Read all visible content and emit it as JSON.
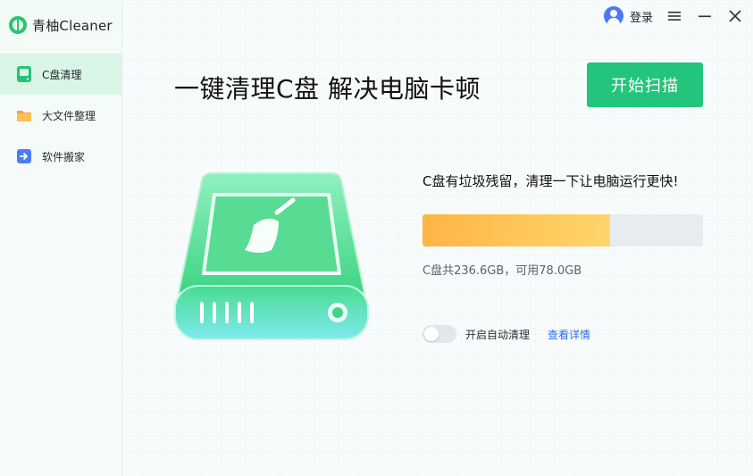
{
  "app": {
    "name": "青柚Cleaner"
  },
  "sidebar": {
    "items": [
      {
        "label": "C盘清理",
        "icon": "c-drive-clean-icon",
        "active": true
      },
      {
        "label": "大文件整理",
        "icon": "folder-icon",
        "active": false
      },
      {
        "label": "软件搬家",
        "icon": "software-move-icon",
        "active": false
      }
    ]
  },
  "topbar": {
    "login_label": "登录"
  },
  "main": {
    "headline": "一键清理C盘 解决电脑卡顿",
    "cta_label": "开始扫描",
    "info_title": "C盘有垃圾残留，清理一下让电脑运行更快!",
    "disk_text": "C盘共236.6GB，可用78.0GB",
    "used_fraction": 0.67,
    "auto_clean_label": "开启自动清理",
    "auto_clean_enabled": false,
    "details_link": "查看详情"
  },
  "colors": {
    "accent": "#22c57b",
    "progress_start": "#ffb545",
    "progress_end": "#ffd56b",
    "link": "#2d6ef0"
  }
}
